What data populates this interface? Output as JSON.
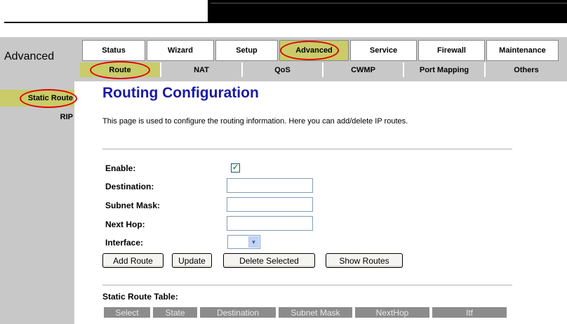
{
  "section_title": "Advanced",
  "top_tabs": [
    {
      "label": "Status",
      "active": false
    },
    {
      "label": "Wizard",
      "active": false
    },
    {
      "label": "Setup",
      "active": false
    },
    {
      "label": "Advanced",
      "active": true
    },
    {
      "label": "Service",
      "active": false
    },
    {
      "label": "Firewall",
      "active": false
    },
    {
      "label": "Maintenance",
      "active": false
    }
  ],
  "sub_tabs": [
    {
      "label": "Route",
      "active": true
    },
    {
      "label": "NAT",
      "active": false
    },
    {
      "label": "QoS",
      "active": false
    },
    {
      "label": "CWMP",
      "active": false
    },
    {
      "label": "Port Mapping",
      "active": false
    },
    {
      "label": "Others",
      "active": false
    }
  ],
  "left_nav": [
    {
      "label": "Static Route",
      "active": true
    },
    {
      "label": "RIP",
      "active": false
    }
  ],
  "page_title": "Routing Configuration",
  "description": "This page is used to configure the routing information. Here you can add/delete IP routes.",
  "form": {
    "enable_label": "Enable:",
    "enable_checked": true,
    "destination_label": "Destination:",
    "destination_value": "",
    "subnet_mask_label": "Subnet Mask:",
    "subnet_mask_value": "",
    "next_hop_label": "Next Hop:",
    "next_hop_value": "",
    "interface_label": "Interface:",
    "interface_value": ""
  },
  "buttons": {
    "add_route": "Add Route",
    "update": "Update",
    "delete_selected": "Delete Selected",
    "show_routes": "Show Routes"
  },
  "table": {
    "title": "Static Route Table:",
    "columns": [
      "Select",
      "State",
      "Destination",
      "Subnet Mask",
      "NextHop",
      "Itf"
    ]
  },
  "colors": {
    "active_tab": "#c9cc69",
    "nav_gray": "#c8c8c8",
    "title_blue": "#1a1aa6",
    "highlight_red": "#e00000"
  }
}
